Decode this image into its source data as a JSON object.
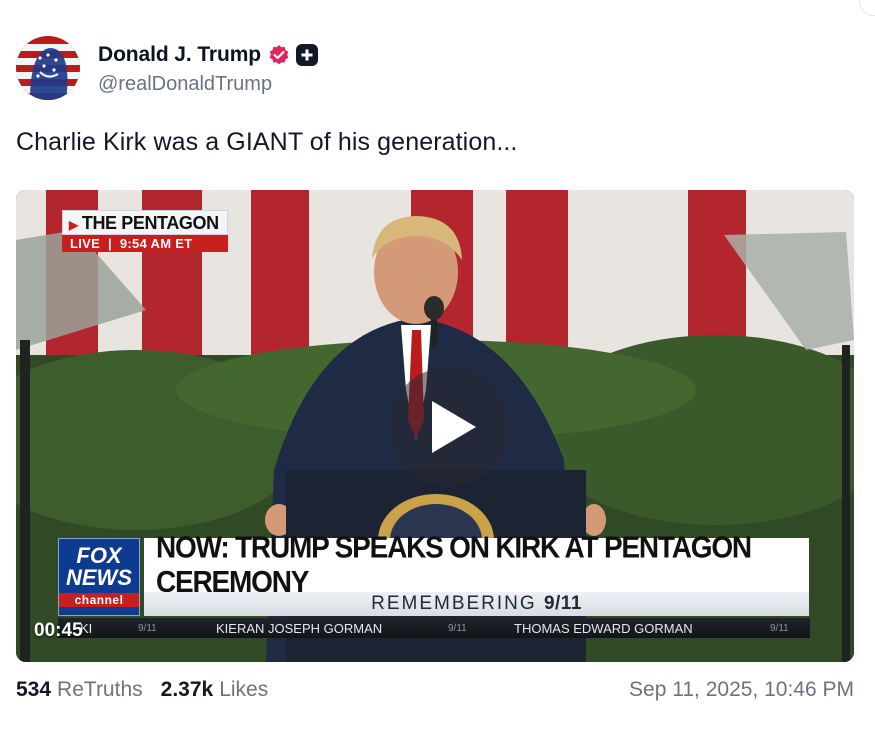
{
  "author": {
    "display_name": "Donald J. Trump",
    "handle": "@realDonaldTrump",
    "verified_icon": "verified-badge-icon",
    "subscription_icon": "plus-badge-icon"
  },
  "post": {
    "text": "Charlie Kirk was a GIANT of his generation..."
  },
  "video": {
    "current_time": "00:45",
    "play_icon": "play-icon",
    "broadcast": {
      "location": "THE PENTAGON",
      "live_label": "LIVE",
      "live_time": "9:54 AM ET",
      "network_line1": "FOX",
      "network_line2": "NEWS",
      "network_line3": "channel",
      "headline": "NOW: TRUMP SPEAKS ON KIRK AT PENTAGON CEREMONY",
      "subheadline_prefix": "REMEMBERING",
      "subheadline_suffix": "9/11",
      "ticker": [
        "KI",
        "9/11",
        "KIERAN JOSEPH GORMAN",
        "9/11",
        "THOMAS EDWARD GORMAN",
        "9/11"
      ]
    }
  },
  "stats": {
    "retruths_count": "534",
    "retruths_label": "ReTruths",
    "likes_count": "2.37k",
    "likes_label": "Likes",
    "timestamp": "Sep 11, 2025, 10:46 PM"
  },
  "colors": {
    "verified": "#e0245e",
    "fox_red": "#c81e1e",
    "fox_blue": "#0c3b8f",
    "muted_text": "#6b7280"
  }
}
